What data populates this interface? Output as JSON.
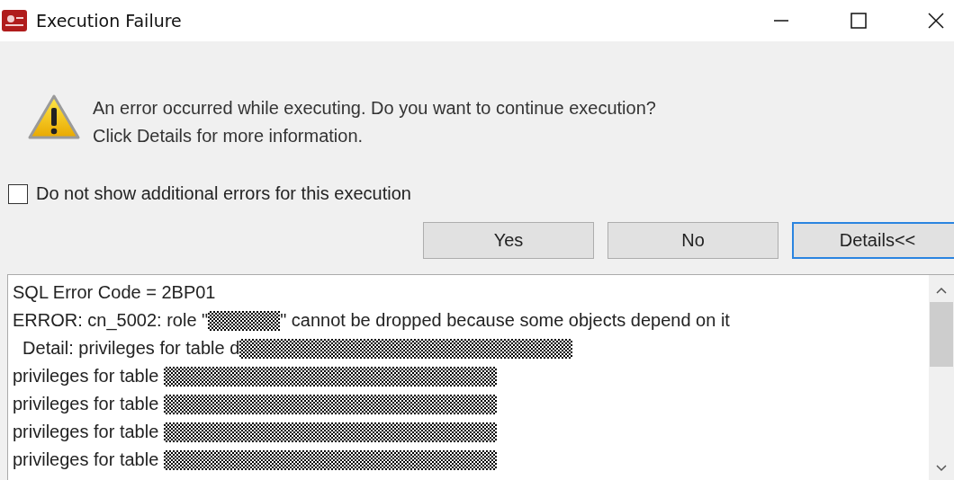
{
  "window": {
    "title": "Execution Failure"
  },
  "message": [
    "An error occurred while executing. Do you want to continue execution?",
    "Click Details for more information."
  ],
  "suppress_checkbox": {
    "label": "Do not show additional errors for this execution",
    "checked": false
  },
  "buttons": [
    {
      "label": "Yes",
      "focused": false
    },
    {
      "label": "No",
      "focused": false
    },
    {
      "label": "Details<<",
      "focused": true
    }
  ],
  "details": [
    [
      {
        "kind": "text",
        "text": "SQL Error Code = 2BP01"
      }
    ],
    [
      {
        "kind": "text",
        "text": "ERROR: cn_5002: role \""
      },
      {
        "kind": "short-redaction"
      },
      {
        "kind": "text",
        "text": "\" cannot be dropped because some objects depend on it"
      }
    ],
    [
      {
        "kind": "text",
        "text": "  Detail: privileges for table d"
      },
      {
        "kind": "redaction"
      }
    ],
    [
      {
        "kind": "text",
        "text": "privileges for table "
      },
      {
        "kind": "redaction"
      }
    ],
    [
      {
        "kind": "text",
        "text": "privileges for table "
      },
      {
        "kind": "redaction"
      }
    ],
    [
      {
        "kind": "text",
        "text": "privileges for table "
      },
      {
        "kind": "redaction"
      }
    ],
    [
      {
        "kind": "text",
        "text": "privileges for table "
      },
      {
        "kind": "redaction"
      }
    ]
  ]
}
